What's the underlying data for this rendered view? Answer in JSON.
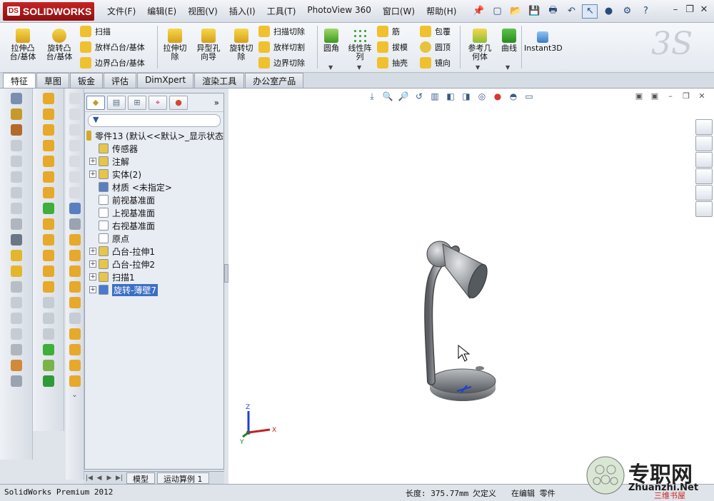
{
  "app": {
    "logo_prefix": "DS",
    "logo_text": "SOLIDWORKS"
  },
  "menus": [
    "文件(F)",
    "编辑(E)",
    "视图(V)",
    "插入(I)",
    "工具(T)",
    "PhotoView 360",
    "窗口(W)",
    "帮助(H)"
  ],
  "command_manager": {
    "extrude_boss": "拉伸凸\n台/基体",
    "revolve_boss": "旋转凸\n台/基体",
    "sweep": "扫描",
    "loft_boss": "放样凸台/基体",
    "boundary_boss": "边界凸台/基体",
    "extrude_cut": "拉伸切\n除",
    "hole_wizard": "异型孔\n向导",
    "revolve_cut": "旋转切\n除",
    "swept_cut": "扫描切除",
    "lofted_cut": "放样切割",
    "boundary_cut": "边界切除",
    "fillet": "圆角",
    "linear_pattern": "线性阵\n列",
    "rib": "筋",
    "draft": "拔模",
    "shell": "抽壳",
    "wrap": "包覆",
    "dome": "圆顶",
    "mirror": "镜向",
    "ref_geometry": "参考几\n何体",
    "curves": "曲线",
    "instant3d": "Instant3D"
  },
  "tabs": [
    {
      "label": "特征",
      "active": true
    },
    {
      "label": "草图",
      "active": false
    },
    {
      "label": "钣金",
      "active": false
    },
    {
      "label": "评估",
      "active": false
    },
    {
      "label": "DimXpert",
      "active": false
    },
    {
      "label": "渲染工具",
      "active": false
    },
    {
      "label": "办公室产品",
      "active": false
    }
  ],
  "tree": {
    "more": "»",
    "filter_icon": "funnel-icon",
    "root": "零件13  (默认<<默认>_显示状态",
    "nodes": [
      {
        "label": "传感器",
        "expand": false,
        "icon": "sensor-icon",
        "color": "#e6c54a"
      },
      {
        "label": "注解",
        "expand": true,
        "icon": "annotation-icon",
        "color": "#e6c54a"
      },
      {
        "label": "实体(2)",
        "expand": true,
        "icon": "solid-bodies-icon",
        "color": "#e6c54a"
      },
      {
        "label": "材质 <未指定>",
        "expand": false,
        "icon": "material-icon",
        "color": "#5a7fc0"
      },
      {
        "label": "前视基准面",
        "expand": false,
        "icon": "plane-icon",
        "color": "#ffffff"
      },
      {
        "label": "上视基准面",
        "expand": false,
        "icon": "plane-icon",
        "color": "#ffffff"
      },
      {
        "label": "右视基准面",
        "expand": false,
        "icon": "plane-icon",
        "color": "#ffffff"
      },
      {
        "label": "原点",
        "expand": false,
        "icon": "origin-icon",
        "color": "#ffffff"
      },
      {
        "label": "凸台-拉伸1",
        "expand": true,
        "icon": "extrude-icon",
        "color": "#e6c54a"
      },
      {
        "label": "凸台-拉伸2",
        "expand": true,
        "icon": "extrude-icon",
        "color": "#e6c54a"
      },
      {
        "label": "扫描1",
        "expand": true,
        "icon": "sweep-icon",
        "color": "#e6c54a"
      },
      {
        "label": "旋转-薄壁7",
        "expand": true,
        "icon": "revolve-icon",
        "color": "#4a7bd0",
        "selected": true
      }
    ]
  },
  "bottom_tabs": [
    "模型",
    "运动算例 1"
  ],
  "status": {
    "app_version": "SolidWorks Premium 2012",
    "length": "长度: 375.77mm",
    "defined": "欠定义",
    "mode": "在编辑 零件"
  },
  "triad": {
    "x": "X",
    "y": "Y",
    "z": "Z"
  },
  "watermark": {
    "text": "专职网",
    "url": "Zhuanzhi.Net",
    "sub": "三维书屋"
  }
}
